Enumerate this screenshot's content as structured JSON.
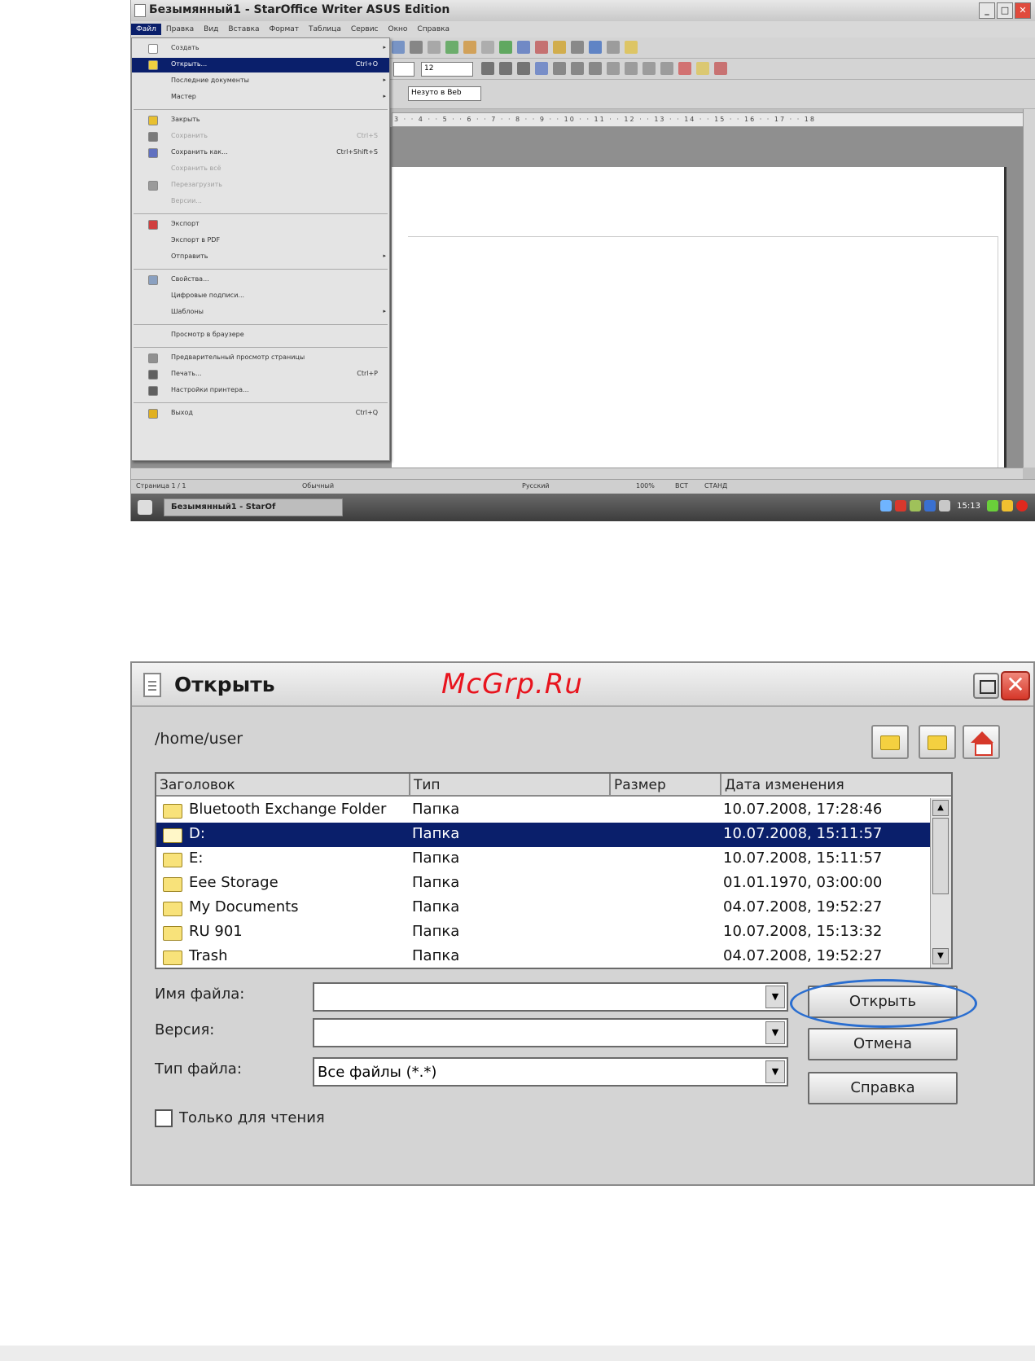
{
  "screenshot1": {
    "title": "Безымянный1 - StarOffice Writer ASUS Edition",
    "menubar": [
      "Файл",
      "Правка",
      "Вид",
      "Вставка",
      "Формат",
      "Таблица",
      "Сервис",
      "Окно",
      "Справка"
    ],
    "file_menu": [
      {
        "label": "Создать",
        "shortcut": "",
        "submenu": true,
        "disabled": false,
        "selected": false
      },
      {
        "label": "Открыть...",
        "shortcut": "Ctrl+O",
        "submenu": false,
        "disabled": false,
        "selected": true
      },
      {
        "label": "Последние документы",
        "shortcut": "",
        "submenu": true,
        "disabled": false,
        "selected": false
      },
      {
        "label": "Мастер",
        "shortcut": "",
        "submenu": true,
        "disabled": false,
        "selected": false
      },
      {
        "label": "Закрыть",
        "shortcut": "",
        "submenu": false,
        "disabled": false,
        "selected": false
      },
      {
        "label": "Сохранить",
        "shortcut": "Ctrl+S",
        "submenu": false,
        "disabled": true,
        "selected": false
      },
      {
        "label": "Сохранить как...",
        "shortcut": "Ctrl+Shift+S",
        "submenu": false,
        "disabled": false,
        "selected": false
      },
      {
        "label": "Сохранить всё",
        "shortcut": "",
        "submenu": false,
        "disabled": true,
        "selected": false
      },
      {
        "label": "Перезагрузить",
        "shortcut": "",
        "submenu": false,
        "disabled": true,
        "selected": false
      },
      {
        "label": "Версии...",
        "shortcut": "",
        "submenu": false,
        "disabled": true,
        "selected": false
      },
      {
        "label": "Экспорт",
        "shortcut": "",
        "submenu": false,
        "disabled": false,
        "selected": false
      },
      {
        "label": "Экспорт в PDF",
        "shortcut": "",
        "submenu": false,
        "disabled": false,
        "selected": false
      },
      {
        "label": "Отправить",
        "shortcut": "",
        "submenu": true,
        "disabled": false,
        "selected": false
      },
      {
        "label": "Свойства...",
        "shortcut": "",
        "submenu": false,
        "disabled": false,
        "selected": false
      },
      {
        "label": "Цифровые подписи...",
        "shortcut": "",
        "submenu": false,
        "disabled": false,
        "selected": false
      },
      {
        "label": "Шаблоны",
        "shortcut": "",
        "submenu": true,
        "disabled": false,
        "selected": false
      },
      {
        "label": "Просмотр в браузере",
        "shortcut": "",
        "submenu": false,
        "disabled": false,
        "selected": false
      },
      {
        "label": "Предварительный просмотр страницы",
        "shortcut": "",
        "submenu": false,
        "disabled": false,
        "selected": false
      },
      {
        "label": "Печать...",
        "shortcut": "Ctrl+P",
        "submenu": false,
        "disabled": false,
        "selected": false
      },
      {
        "label": "Настройки принтера...",
        "shortcut": "",
        "submenu": false,
        "disabled": false,
        "selected": false
      },
      {
        "label": "Выход",
        "shortcut": "Ctrl+Q",
        "submenu": false,
        "disabled": false,
        "selected": false
      }
    ],
    "font_size": "12",
    "web_mode": "Незуто в Веb",
    "ruler": "3 · · 4 · · 5 · · 6 · · 7 · · 8 · · 9 · · 10 · · 11 · · 12 · · 13 · · 14 · · 15 · · 16 · · 17 · · 18",
    "status": {
      "page": "Страница 1 / 1",
      "style": "Обычный",
      "lang": "Русский",
      "zoom": "100%",
      "ins": "ВСТ",
      "std": "СТАНД"
    },
    "taskbar_item": "Безымянный1 - StarOf",
    "clock": "15:13"
  },
  "dialog": {
    "title": "Открыть",
    "watermark": "McGrp.Ru",
    "path": "/home/user",
    "columns": [
      "Заголовок",
      "Тип",
      "Размер",
      "Дата изменения"
    ],
    "rows": [
      {
        "name": "Bluetooth Exchange Folder",
        "type": "Папка",
        "size": "",
        "date": "10.07.2008, 17:28:46"
      },
      {
        "name": "D:",
        "type": "Папка",
        "size": "",
        "date": "10.07.2008, 15:11:57"
      },
      {
        "name": "E:",
        "type": "Папка",
        "size": "",
        "date": "10.07.2008, 15:11:57"
      },
      {
        "name": "Eee Storage",
        "type": "Папка",
        "size": "",
        "date": "01.01.1970, 03:00:00"
      },
      {
        "name": "My Documents",
        "type": "Папка",
        "size": "",
        "date": "04.07.2008, 19:52:27"
      },
      {
        "name": "RU 901",
        "type": "Папка",
        "size": "",
        "date": "10.07.2008, 15:13:32"
      },
      {
        "name": "Trash",
        "type": "Папка",
        "size": "",
        "date": "04.07.2008, 19:52:27"
      }
    ],
    "selected_row": 1,
    "filename_label": "Имя файла:",
    "filename_value": "",
    "version_label": "Версия:",
    "version_value": "",
    "filetype_label": "Тип файла:",
    "filetype_value": "Все файлы (*.*)",
    "open_button": "Открыть",
    "cancel_button": "Отмена",
    "help_button": "Справка",
    "readonly_label": "Только для чтения",
    "readonly_checked": false
  }
}
